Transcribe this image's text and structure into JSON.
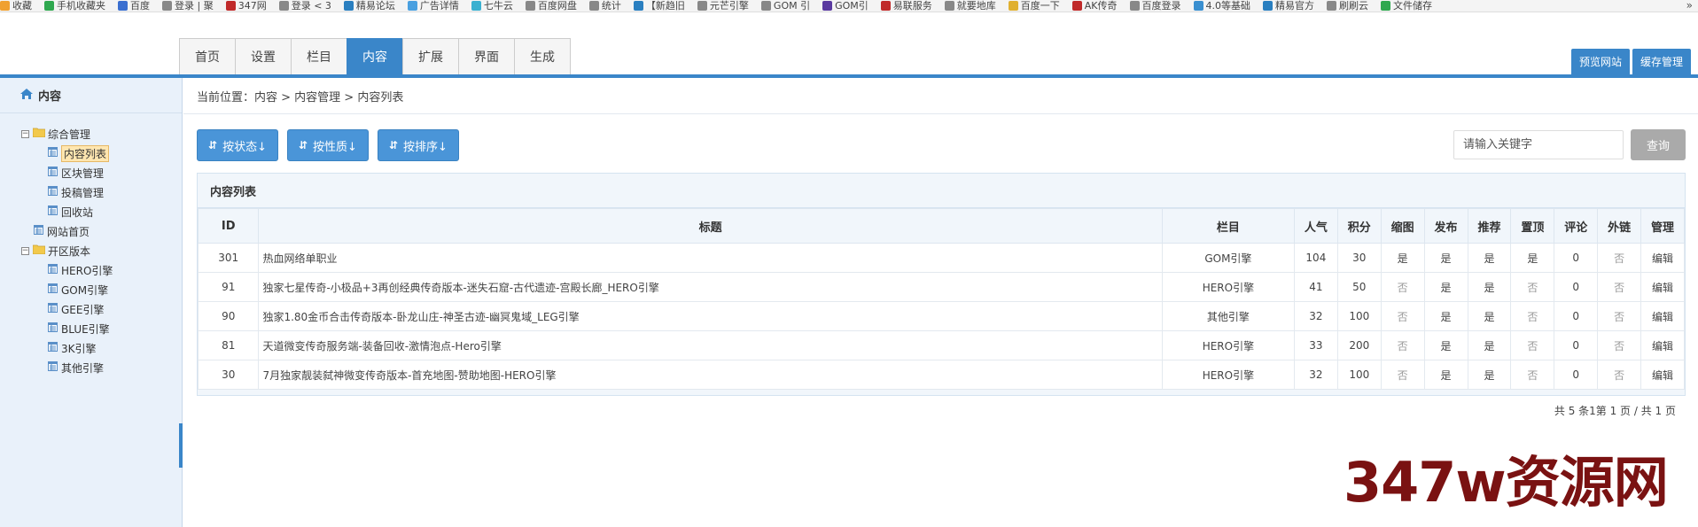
{
  "bookmarks": {
    "items": [
      {
        "label": "收藏",
        "color": "#f0a030"
      },
      {
        "label": "手机收藏夹",
        "color": "#2fa84f"
      },
      {
        "label": "百度",
        "color": "#3a6fd0"
      },
      {
        "label": "登录 | 聚",
        "color": "#888888"
      },
      {
        "label": "347网",
        "color": "#c02a2a"
      },
      {
        "label": "登录 < 3",
        "color": "#888888"
      },
      {
        "label": "精易论坛",
        "color": "#2a7fc0"
      },
      {
        "label": "广告详情",
        "color": "#4aa0e0"
      },
      {
        "label": "七牛云",
        "color": "#3ab0d0"
      },
      {
        "label": "百度网盘",
        "color": "#888888"
      },
      {
        "label": "统计",
        "color": "#888888"
      },
      {
        "label": "【新趋旧",
        "color": "#2a7fc0"
      },
      {
        "label": "元芒引擎",
        "color": "#888888"
      },
      {
        "label": "GOM 引",
        "color": "#888888"
      },
      {
        "label": "GOM引",
        "color": "#5a3aa0"
      },
      {
        "label": "易联服务",
        "color": "#c02a2a"
      },
      {
        "label": "就要地库",
        "color": "#888888"
      },
      {
        "label": "百度一下",
        "color": "#e0b030"
      },
      {
        "label": "AK传奇",
        "color": "#c02a2a"
      },
      {
        "label": "百度登录",
        "color": "#888888"
      },
      {
        "label": "4.0等基础",
        "color": "#3a8fd0"
      },
      {
        "label": "精易官方",
        "color": "#2a7fc0"
      },
      {
        "label": "刷刷云",
        "color": "#888888"
      },
      {
        "label": "文件储存",
        "color": "#2fa84f"
      }
    ],
    "more": "»"
  },
  "nav": {
    "tabs": [
      {
        "label": "首页",
        "active": false
      },
      {
        "label": "设置",
        "active": false
      },
      {
        "label": "栏目",
        "active": false
      },
      {
        "label": "内容",
        "active": true
      },
      {
        "label": "扩展",
        "active": false
      },
      {
        "label": "界面",
        "active": false
      },
      {
        "label": "生成",
        "active": false
      }
    ],
    "preview_label": "预览网站",
    "cache_label": "缓存管理"
  },
  "sidebar": {
    "title": "内容",
    "groups": [
      {
        "label": "综合管理",
        "children": [
          {
            "label": "内容列表",
            "selected": true
          },
          {
            "label": "区块管理",
            "selected": false
          },
          {
            "label": "投稿管理",
            "selected": false
          },
          {
            "label": "回收站",
            "selected": false
          }
        ]
      }
    ],
    "standalone": "网站首页",
    "group2": {
      "label": "开区版本",
      "children": [
        "HERO引擎",
        "GOM引擎",
        "GEE引擎",
        "BLUE引擎",
        "3K引擎",
        "其他引擎"
      ]
    }
  },
  "breadcrumb": "当前位置：内容 > 内容管理 > 内容列表",
  "toolbar": {
    "btn_status": "按状态↓",
    "btn_nature": "按性质↓",
    "btn_sort": "按排序↓",
    "search_placeholder": "请输入关键字",
    "query_label": "查询"
  },
  "panel": {
    "title": "内容列表",
    "columns": [
      "ID",
      "标题",
      "栏目",
      "人气",
      "积分",
      "缩图",
      "发布",
      "推荐",
      "置顶",
      "评论",
      "外链",
      "管理"
    ],
    "rows": [
      {
        "id": "301",
        "title": "热血网络单职业",
        "category": "GOM引擎",
        "views": "104",
        "points": "30",
        "thumb": "是",
        "publish": "是",
        "recommend": "是",
        "top": "是",
        "comments": "0",
        "outlink": "否",
        "manage": "编辑"
      },
      {
        "id": "91",
        "title": "独家七星传奇-小极品+3再创经典传奇版本-迷失石窟-古代遗迹-宫殿长廊_HERO引擎",
        "category": "HERO引擎",
        "views": "41",
        "points": "50",
        "thumb": "否",
        "publish": "是",
        "recommend": "是",
        "top": "否",
        "comments": "0",
        "outlink": "否",
        "manage": "编辑"
      },
      {
        "id": "90",
        "title": "独家1.80金币合击传奇版本-卧龙山庄-神圣古迹-幽冥鬼域_LEG引擎",
        "category": "其他引擎",
        "views": "32",
        "points": "100",
        "thumb": "否",
        "publish": "是",
        "recommend": "是",
        "top": "否",
        "comments": "0",
        "outlink": "否",
        "manage": "编辑"
      },
      {
        "id": "81",
        "title": "天道微变传奇服务端-装备回收-激情泡点-Hero引擎",
        "category": "HERO引擎",
        "views": "33",
        "points": "200",
        "thumb": "否",
        "publish": "是",
        "recommend": "是",
        "top": "否",
        "comments": "0",
        "outlink": "否",
        "manage": "编辑"
      },
      {
        "id": "30",
        "title": "7月独家靓装弑神微变传奇版本-首充地图-赞助地图-HERO引擎",
        "category": "HERO引擎",
        "views": "32",
        "points": "100",
        "thumb": "否",
        "publish": "是",
        "recommend": "是",
        "top": "否",
        "comments": "0",
        "outlink": "否",
        "manage": "编辑"
      }
    ],
    "pager": "共 5 条1第 1 页 / 共 1 页"
  },
  "watermark": "347w资源网",
  "colors": {
    "accent": "#3a86c9",
    "watermark": "#7a1212"
  }
}
